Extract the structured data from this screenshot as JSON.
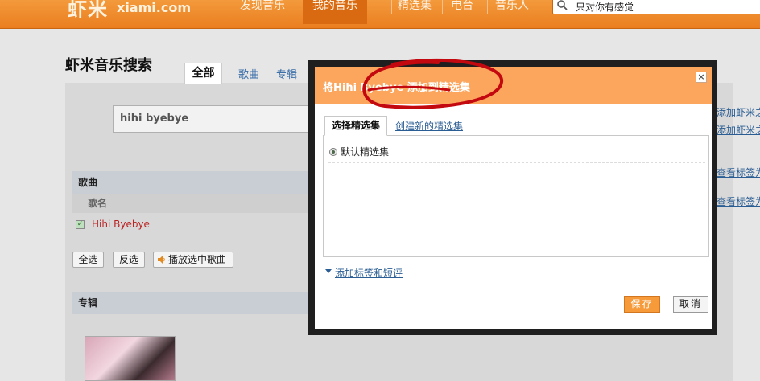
{
  "site": {
    "logo": "虾米",
    "logo_sub": "xiami.com",
    "nav": [
      "发现音乐",
      "我的音乐",
      "精选集",
      "电台",
      "音乐人"
    ],
    "search_query": "只对你有感觉"
  },
  "page": {
    "title": "虾米音乐搜索",
    "tabs": [
      "全部",
      "歌曲",
      "专辑"
    ],
    "search_value": "hihi byebye"
  },
  "songs": {
    "section_title": "歌曲",
    "column_header": "歌名",
    "rows": [
      {
        "name": "Hihi Byebye",
        "checked": true
      }
    ],
    "select_all": "全选",
    "invert": "反选",
    "play_selected": "播放选中歌曲"
  },
  "albums": {
    "section_title": "专辑"
  },
  "right_links": [
    "添加虾米之",
    "添加虾米之",
    "查看标签为",
    "查看标签为"
  ],
  "dialog": {
    "title": "将Hihi Byebye 添加到精选集",
    "tabs": [
      "选择精选集",
      "创建新的精选集"
    ],
    "options": [
      {
        "label": "默认精选集",
        "selected": true
      }
    ],
    "expand_link": "添加标签和短评",
    "save": "保存",
    "cancel": "取消",
    "annotation_color": "#c3090f"
  }
}
